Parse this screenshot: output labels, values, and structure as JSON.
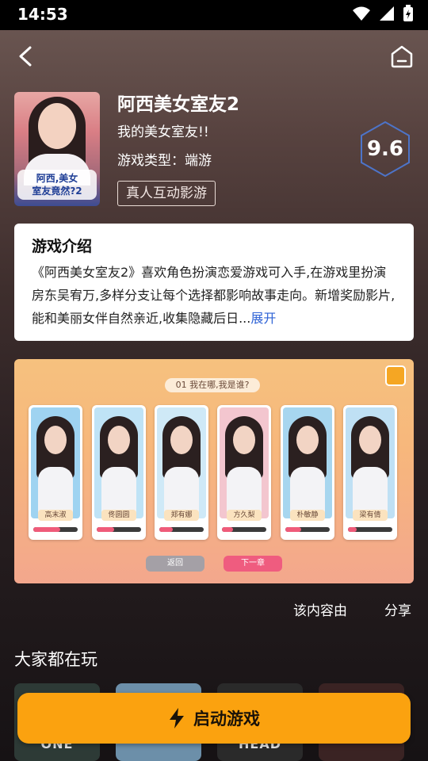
{
  "status_bar": {
    "time": "14:53"
  },
  "game": {
    "title": "阿西美女室友2",
    "subtitle": "我的美女室友!!",
    "type_label": "游戏类型：端游",
    "tag": "真人互动影游",
    "score": "9.6",
    "cover_logo_line1": "阿西,美女",
    "cover_logo_line2": "室友竟然?2"
  },
  "intro": {
    "heading": "游戏介绍",
    "text": "《阿西美女室友2》喜欢角色扮演恋爱游戏可入手,在游戏里扮演房东吴宥万,多样分支让每个选择都影响故事走向。新增奖励影片,能和美丽女伴自然亲近,收集隐藏后日...",
    "more": "展开"
  },
  "screenshot": {
    "banner": "01  我在哪,我是谁?",
    "characters": [
      {
        "name": "高末淑",
        "bg": "#9fd3f1",
        "affinity": 0.6
      },
      {
        "name": "佟圆圆",
        "bg": "#bfe3f6",
        "affinity": 0.4
      },
      {
        "name": "郑有娜",
        "bg": "#cfe9f7",
        "affinity": 0.3
      },
      {
        "name": "方久梨",
        "bg": "#f3c6cf",
        "affinity": 0.25
      },
      {
        "name": "朴敏静",
        "bg": "#a7d6ef",
        "affinity": 0.35
      },
      {
        "name": "梁有倩",
        "bg": "#bfe0f4",
        "affinity": 0.2
      }
    ],
    "back_button": "返回",
    "next_button": "下一章"
  },
  "actions": {
    "report": "该内容由",
    "share": "分享"
  },
  "section": {
    "title": "大家都在玩"
  },
  "recommended": [
    {
      "label": "ONE",
      "color": "#2d3a36"
    },
    {
      "label": "",
      "color": "#6c8fa9"
    },
    {
      "label": "CRASH HEAD",
      "color": "#2a2a2a"
    },
    {
      "label": "",
      "color": "#3a2323"
    }
  ],
  "launch": {
    "label": "启动游戏"
  },
  "colors": {
    "accent": "#fba20f",
    "link": "#2f63d6"
  }
}
